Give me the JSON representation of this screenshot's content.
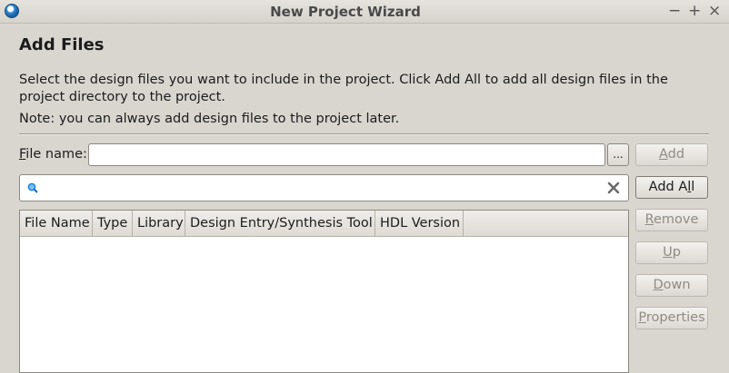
{
  "window": {
    "title": "New Project Wizard",
    "controls": {
      "minimize": "−",
      "maximize": "+",
      "close": "×"
    }
  },
  "page": {
    "heading": "Add Files",
    "description": "Select the design files you want to include in the project. Click Add All to add all design files in the project directory to the project.",
    "note": "Note: you can always add design files to the project later."
  },
  "file_name": {
    "label": "File name:",
    "mnemonic": "F",
    "label_rest": "ile name:",
    "value": "",
    "browse_label": "..."
  },
  "search": {
    "value": "",
    "icon": "search-icon",
    "clear_icon": "clear-icon"
  },
  "table": {
    "columns": [
      "File Name",
      "Type",
      "Library",
      "Design Entry/Synthesis Tool",
      "HDL Version"
    ],
    "rows": []
  },
  "buttons": {
    "add": {
      "label": "Add",
      "pre": "",
      "mn": "A",
      "post": "dd",
      "enabled": false
    },
    "add_all": {
      "label": "Add All",
      "pre": "Add A",
      "mn": "l",
      "post": "l",
      "enabled": true
    },
    "remove": {
      "label": "Remove",
      "pre": "",
      "mn": "R",
      "post": "emove",
      "enabled": false
    },
    "up": {
      "label": "Up",
      "pre": "",
      "mn": "U",
      "post": "p",
      "enabled": false
    },
    "down": {
      "label": "Down",
      "pre": "",
      "mn": "D",
      "post": "own",
      "enabled": false
    },
    "properties": {
      "label": "Properties",
      "pre": "",
      "mn": "P",
      "post": "roperties",
      "enabled": false
    }
  },
  "colors": {
    "background": "#d9d5cf",
    "disabled_text": "#8f8b85",
    "search_icon": "#1e88e5"
  }
}
